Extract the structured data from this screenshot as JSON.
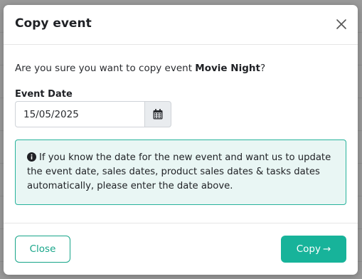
{
  "modal": {
    "title": "Copy event",
    "confirm_prefix": "Are you sure you want to copy event ",
    "event_name": "Movie Night",
    "confirm_suffix": "?",
    "date_label": "Event Date",
    "date_value": "15/05/2025",
    "info_text": "If you know the date for the new event and want us to update the event date, sales dates, product sales dates & tasks dates automatically, please enter the date above.",
    "close_label": "Close",
    "copy_label": "Copy",
    "copy_arrow": "→"
  },
  "icons": {
    "close": "close-icon",
    "calendar": "calendar-icon",
    "info": "info-circle-icon"
  },
  "colors": {
    "accent": "#17b39a",
    "info_bg": "#e9f6f4",
    "info_border": "#27b39c"
  }
}
